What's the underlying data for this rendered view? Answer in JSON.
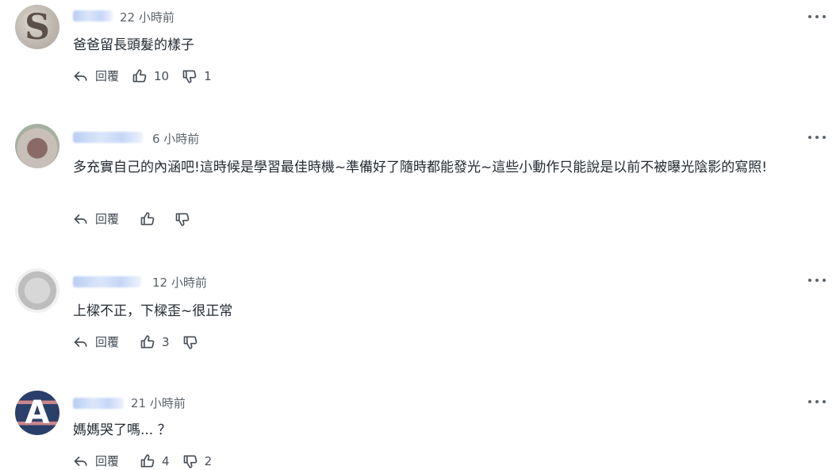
{
  "comments": [
    {
      "time": "22 小時前",
      "text": "爸爸留長頭髮的樣子",
      "reply": "回覆",
      "likes": "10",
      "dislikes": "1",
      "avatar_letter": "S"
    },
    {
      "time": "6 小時前",
      "text": "多充實自己的內涵吧!這時候是學習最佳時機~準備好了隨時都能發光~這些小動作只能說是以前不被曝光陰影的寫照!",
      "reply": "回覆",
      "likes": "",
      "dislikes": ""
    },
    {
      "time": "12 小時前",
      "text": "上樑不正，下樑歪~很正常",
      "reply": "回覆",
      "likes": "3",
      "dislikes": ""
    },
    {
      "time": "21 小時前",
      "text": "媽媽哭了嗎... ？",
      "reply": "回覆",
      "likes": "4",
      "dislikes": "2",
      "avatar_letter": "A"
    }
  ],
  "icons": {
    "reply": "reply-icon",
    "like": "thumbs-up-icon",
    "dislike": "thumbs-down-icon",
    "more": "more-options-icon"
  }
}
